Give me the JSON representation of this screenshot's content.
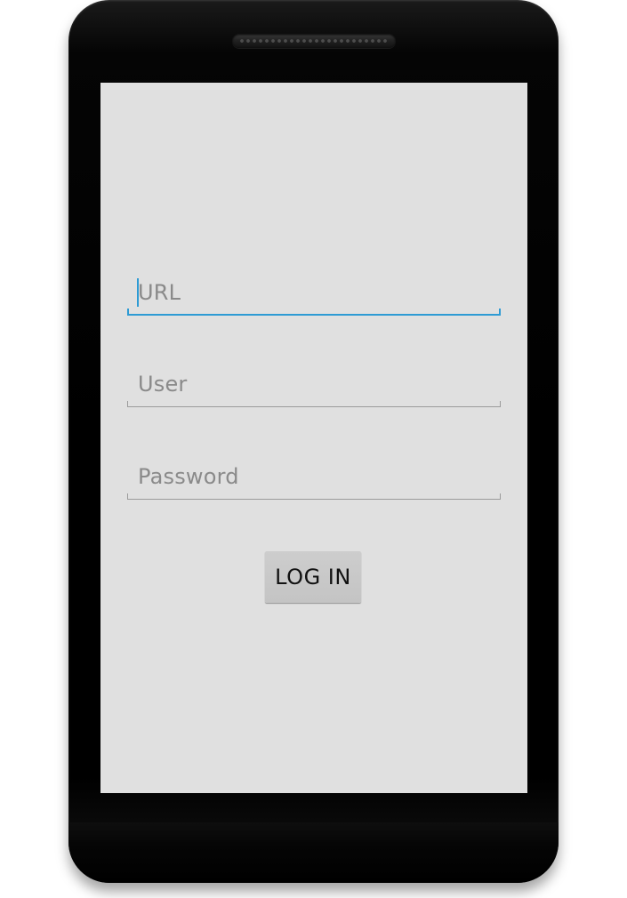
{
  "login_form": {
    "url_field": {
      "placeholder": "URL",
      "value": "",
      "focused": true
    },
    "user_field": {
      "placeholder": "User",
      "value": ""
    },
    "password_field": {
      "placeholder": "Password",
      "value": ""
    },
    "login_button_label": "LOG IN"
  },
  "colors": {
    "screen_background": "#e0e0e0",
    "focus_accent": "#2e9bd4",
    "hint_text": "#8a8a8a",
    "button_background": "#c8c8c8"
  }
}
